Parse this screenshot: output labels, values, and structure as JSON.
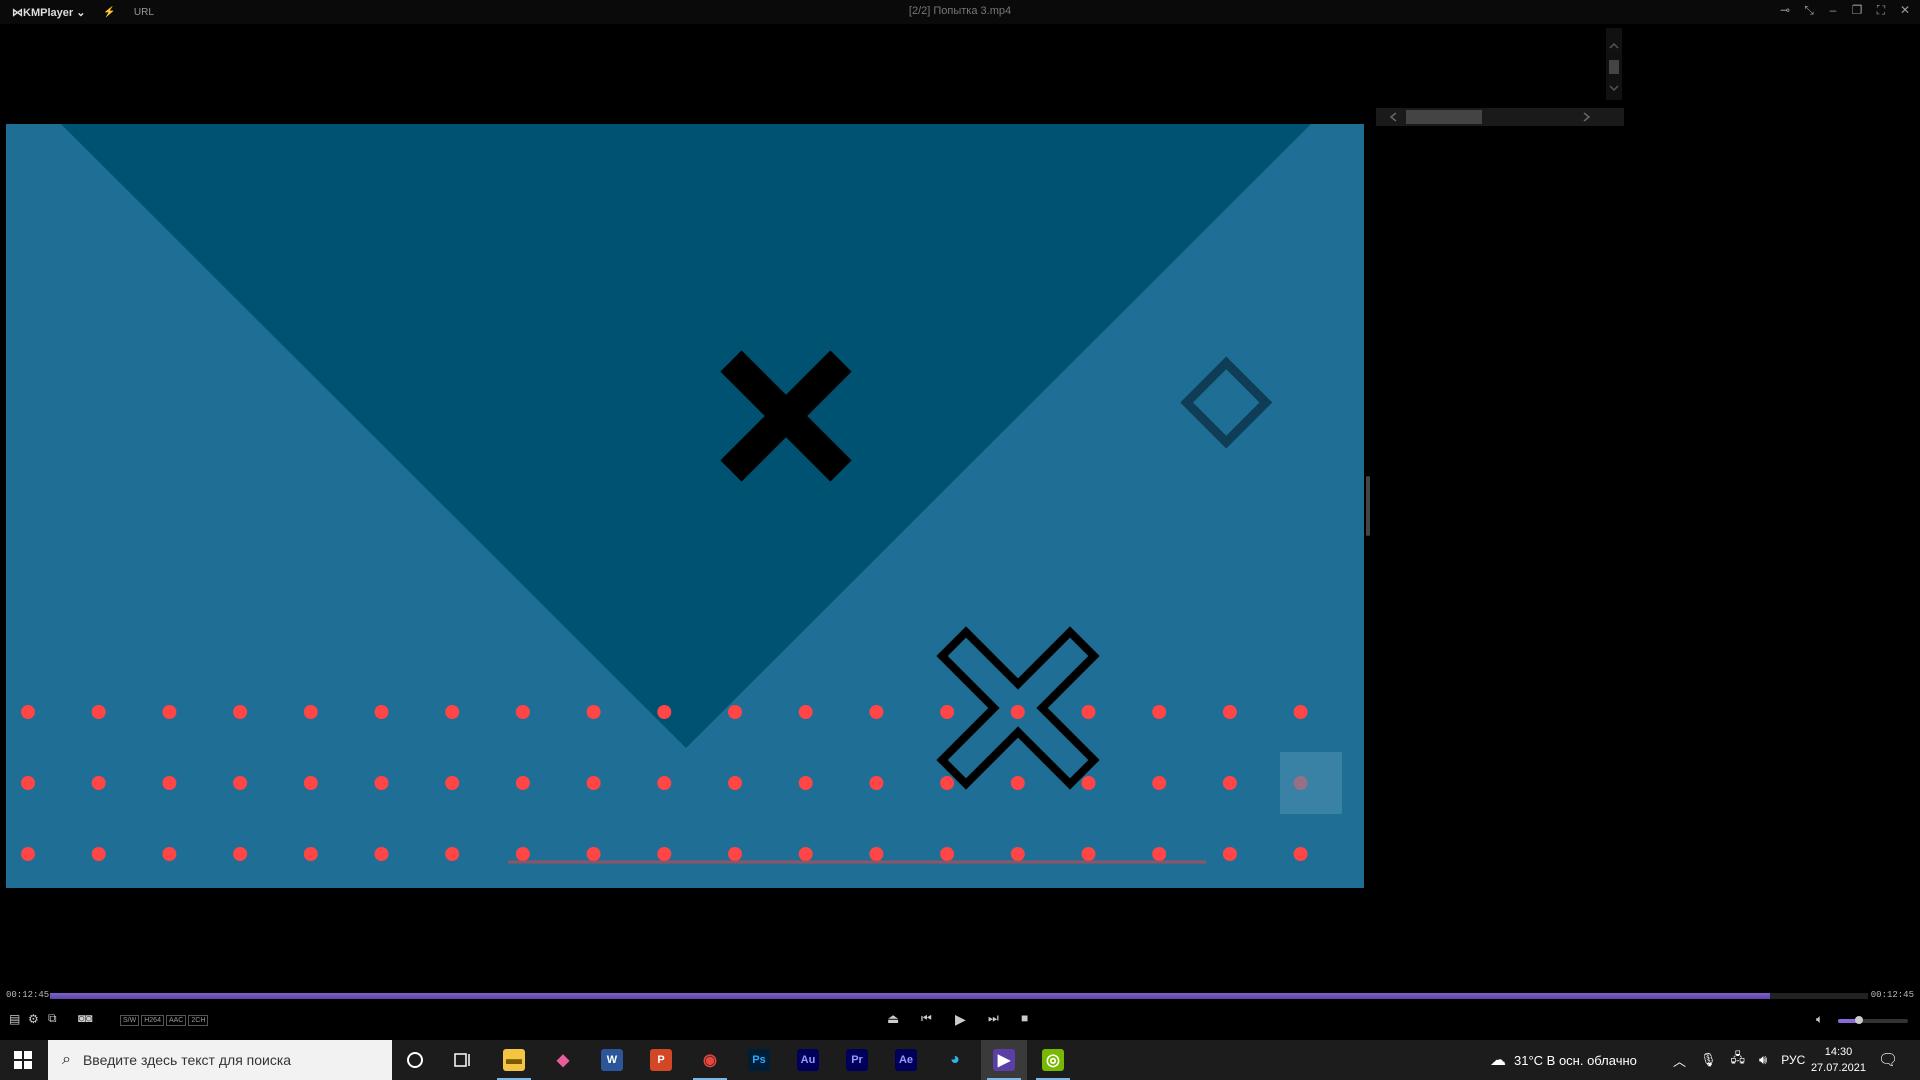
{
  "titlebar": {
    "app_name": "KMPlayer",
    "url_label": "URL",
    "file_title": "[2/2] Попытка 3.mp4",
    "icons": [
      "pin-icon",
      "compact-icon",
      "minimize-icon",
      "restore-icon",
      "fullscreen-icon",
      "close-icon"
    ]
  },
  "playback": {
    "current_time": "00:12:45",
    "total_time": "00:12:45",
    "progress": 0.946,
    "volume": 0.3
  },
  "video_info_tags": [
    "S/W",
    "H264",
    "AAC",
    "2CH"
  ],
  "colors": {
    "scene_light": "#1f6e95",
    "scene_dark": "#005272",
    "dot": "#ff4545",
    "seek_fill": "#6d52b8"
  },
  "taskbar": {
    "search_placeholder": "Введите здесь текст для поиска",
    "apps": [
      {
        "name": "file-explorer-icon",
        "label": ""
      },
      {
        "name": "paint-3d-icon",
        "label": ""
      },
      {
        "name": "word-icon",
        "label": "W"
      },
      {
        "name": "powerpoint-icon",
        "label": "P"
      },
      {
        "name": "chrome-icon",
        "label": ""
      },
      {
        "name": "photoshop-icon",
        "label": "Ps"
      },
      {
        "name": "audition-icon",
        "label": "Au"
      },
      {
        "name": "premiere-icon",
        "label": "Pr"
      },
      {
        "name": "after-effects-icon",
        "label": "Ae"
      },
      {
        "name": "edge-icon",
        "label": ""
      },
      {
        "name": "kmplayer-icon",
        "label": ""
      },
      {
        "name": "nvidia-icon",
        "label": ""
      }
    ],
    "weather": "31°C  В осн. облачно",
    "language": "РУС",
    "time": "14:30",
    "date": "27.07.2021"
  }
}
